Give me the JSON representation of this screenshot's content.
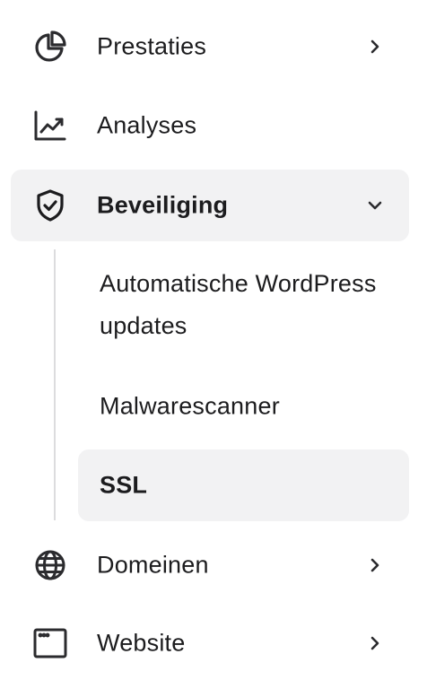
{
  "sidebar": {
    "items": [
      {
        "label": "Prestaties",
        "icon": "pie-chart-icon",
        "has_chevron": true,
        "chevron": "chevron-right-icon"
      },
      {
        "label": "Analyses",
        "icon": "trend-chart-icon",
        "has_chevron": false
      },
      {
        "label": "Beveiliging",
        "icon": "shield-check-icon",
        "active": true,
        "expanded": true,
        "chevron": "chevron-down-icon"
      },
      {
        "label": "Domeinen",
        "icon": "globe-icon",
        "has_chevron": true,
        "chevron": "chevron-right-icon"
      },
      {
        "label": "Website",
        "icon": "browser-window-icon",
        "has_chevron": true,
        "chevron": "chevron-right-icon"
      }
    ],
    "security_submenu": [
      {
        "label": "Automatische WordPress updates"
      },
      {
        "label": "Malwarescanner"
      },
      {
        "label": "SSL",
        "active": true
      }
    ]
  },
  "colors": {
    "text": "#1c1c1e",
    "active_background": "#f2f2f3",
    "divider": "#dcdcde"
  }
}
